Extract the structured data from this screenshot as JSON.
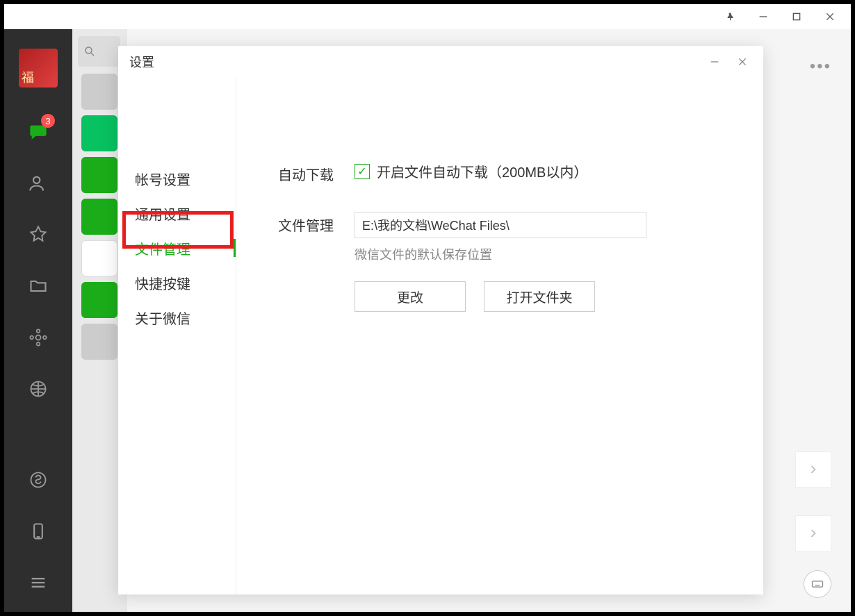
{
  "window": {
    "pin_tooltip": "置顶",
    "minimize_tooltip": "最小化",
    "maximize_tooltip": "最大化",
    "close_tooltip": "关闭"
  },
  "sidebar": {
    "chat_badge": "3",
    "icons": {
      "chat": "chat-icon",
      "contacts": "contacts-icon",
      "favorites": "favorites-icon",
      "files": "files-icon",
      "moments": "moments-icon",
      "browse": "browse-icon",
      "miniprogram": "miniprogram-icon",
      "phone": "phone-icon",
      "menu": "menu-icon"
    }
  },
  "chat_area": {
    "more_label": "•••"
  },
  "settings": {
    "title": "设置",
    "nav": {
      "account": "帐号设置",
      "general": "通用设置",
      "files": "文件管理",
      "shortcuts": "快捷按键",
      "about": "关于微信"
    },
    "content": {
      "auto_download_label": "自动下载",
      "auto_download_checkbox_text": "开启文件自动下载（200MB以内）",
      "file_manage_label": "文件管理",
      "file_path": "E:\\我的文档\\WeChat Files\\",
      "file_path_hint": "微信文件的默认保存位置",
      "change_button": "更改",
      "open_folder_button": "打开文件夹"
    }
  }
}
